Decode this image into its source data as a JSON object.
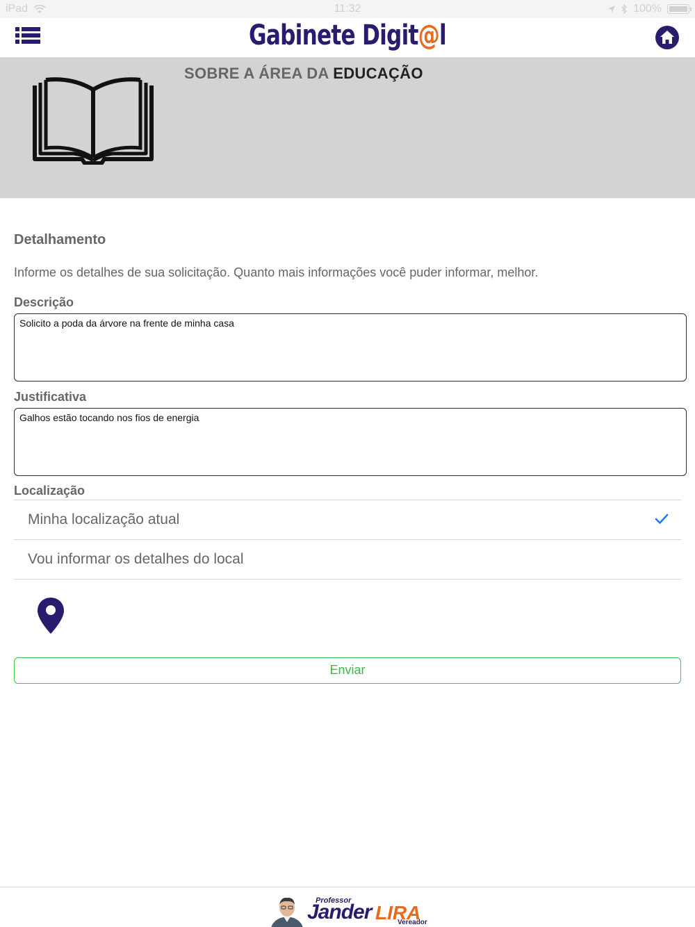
{
  "status_bar": {
    "device": "iPad",
    "time": "11:32",
    "battery": "100%"
  },
  "navbar": {
    "brand_main": "Gabinete Digit",
    "brand_accent": "@",
    "brand_end": "l",
    "menu_icon": "list-icon",
    "home_icon": "home-icon"
  },
  "hero": {
    "title_prefix": "SOBRE A ÁREA DA ",
    "title_strong": "EDUCAÇÃO",
    "icon": "open-book-icon"
  },
  "form": {
    "section_title": "Detalhamento",
    "intro": "Informe os detalhes de sua solicitação. Quanto mais informações você puder informar, melhor.",
    "description_label": "Descrição",
    "description_value": "Solicito a poda da árvore na frente de minha casa",
    "justification_label": "Justificativa",
    "justification_value": "Galhos estão tocando nos fios de energia",
    "location_label": "Localização",
    "location_options": [
      {
        "label": "Minha localização atual",
        "selected": true
      },
      {
        "label": "Vou informar os detalhes do local",
        "selected": false
      }
    ],
    "pin_icon": "map-pin-icon",
    "submit_label": "Enviar"
  },
  "footer": {
    "prefix": "Professor",
    "name_first": "Jander",
    "name_last": "LIRA",
    "role": "Vereador"
  },
  "colors": {
    "brand_purple": "#2b1b6e",
    "brand_orange": "#e86a1e",
    "hero_bg": "#d3d3d3",
    "submit_green": "#3cc84b",
    "check_blue": "#1a7ef0"
  }
}
